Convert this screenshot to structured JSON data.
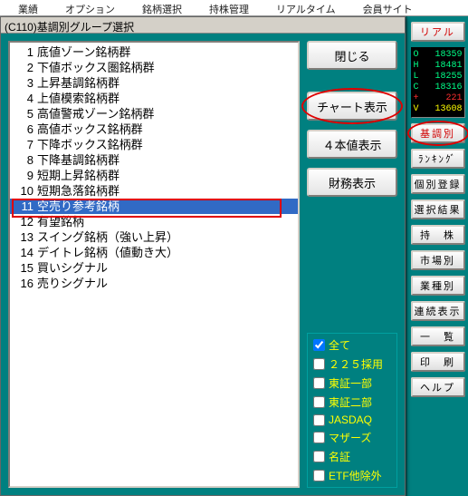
{
  "toolbar": {
    "items": [
      "業績",
      "オプション",
      "銘柄選択",
      "持株管理",
      "リアルタイム",
      "会員サイト"
    ]
  },
  "dialog": {
    "title": "(C110)基調別グループ選択",
    "list": [
      {
        "n": "1",
        "label": "底値ゾーン銘柄群"
      },
      {
        "n": "2",
        "label": "下値ボックス圏銘柄群"
      },
      {
        "n": "3",
        "label": "上昇基調銘柄群"
      },
      {
        "n": "4",
        "label": "上値模索銘柄群"
      },
      {
        "n": "5",
        "label": "高値警戒ゾーン銘柄群"
      },
      {
        "n": "6",
        "label": "高値ボックス銘柄群"
      },
      {
        "n": "7",
        "label": "下降ボックス銘柄群"
      },
      {
        "n": "8",
        "label": "下降基調銘柄群"
      },
      {
        "n": "9",
        "label": "短期上昇銘柄群"
      },
      {
        "n": "10",
        "label": "短期急落銘柄群"
      },
      {
        "n": "11",
        "label": "空売り参考銘柄"
      },
      {
        "n": "12",
        "label": "有望銘柄"
      },
      {
        "n": "13",
        "label": "スイング銘柄（強い上昇）"
      },
      {
        "n": "14",
        "label": "デイトレ銘柄（値動き大）"
      },
      {
        "n": "15",
        "label": "買いシグナル"
      },
      {
        "n": "16",
        "label": "売りシグナル"
      }
    ],
    "selected_index": 10,
    "buttons": {
      "close": "閉じる",
      "chart": "チャート表示",
      "four": "４本値表示",
      "finance": "財務表示"
    },
    "checks": [
      {
        "label": "全て",
        "checked": true
      },
      {
        "label": "２２５採用",
        "checked": false
      },
      {
        "label": "東証一部",
        "checked": false
      },
      {
        "label": "東証二部",
        "checked": false
      },
      {
        "label": "JASDAQ",
        "checked": false
      },
      {
        "label": "マザーズ",
        "checked": false
      },
      {
        "label": "名証",
        "checked": false
      },
      {
        "label": "ETF他除外",
        "checked": false
      }
    ]
  },
  "side": {
    "real": "リアル",
    "ticker": [
      {
        "k": "O",
        "v": "18359",
        "c": "#00ff88"
      },
      {
        "k": "H",
        "v": "18481",
        "c": "#00ff88"
      },
      {
        "k": "L",
        "v": "18255",
        "c": "#00ff88"
      },
      {
        "k": "C",
        "v": "18316",
        "c": "#00ff88"
      },
      {
        "k": "+",
        "v": "221",
        "c": "#ff3030"
      },
      {
        "k": "V",
        "v": "13608",
        "c": "#ffff00"
      }
    ],
    "buttons": [
      "基調別",
      "ﾗﾝｷﾝｸﾞ",
      "個別登録",
      "選択結果",
      "持　株",
      "市場別",
      "業種別",
      "連続表示",
      "一　覧",
      "印　刷",
      "ヘルプ"
    ]
  }
}
